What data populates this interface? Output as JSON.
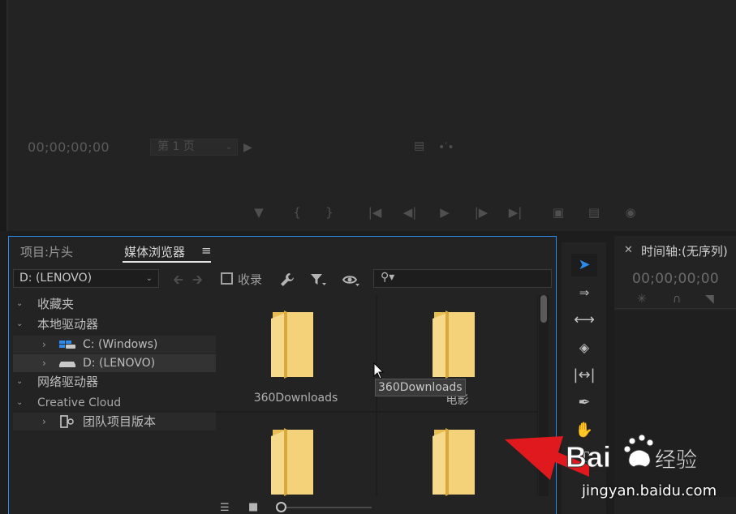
{
  "monitor": {
    "timecode": "00;00;00;00",
    "page_select": "第 1 页"
  },
  "browser": {
    "tabs": [
      {
        "label": "项目:片头"
      },
      {
        "label": "媒体浏览器"
      }
    ],
    "tab_menu": "≡",
    "drive_select": "D: (LENOVO)",
    "favorites_label": "收录",
    "tree": [
      {
        "label": "收藏夹"
      },
      {
        "label": "本地驱动器"
      },
      {
        "label": "C: (Windows)"
      },
      {
        "label": "D: (LENOVO)"
      },
      {
        "label": "网络驱动器"
      },
      {
        "label": "Creative Cloud"
      },
      {
        "label": "团队项目版本"
      }
    ],
    "folders": [
      {
        "name": "360Downloads"
      },
      {
        "name": "电影"
      },
      {
        "name": ""
      },
      {
        "name": ""
      }
    ],
    "tooltip": "360Downloads"
  },
  "timeline": {
    "title": "时间轴:(无序列)",
    "timecode": "00;00;00;00"
  },
  "watermark": {
    "logo_text": "Bai经验",
    "url": "jingyan.baidu.com"
  },
  "colors": {
    "accent": "#2d8ceb",
    "folder": "#f3d27a",
    "watermark_arrow": "#e0191e"
  }
}
